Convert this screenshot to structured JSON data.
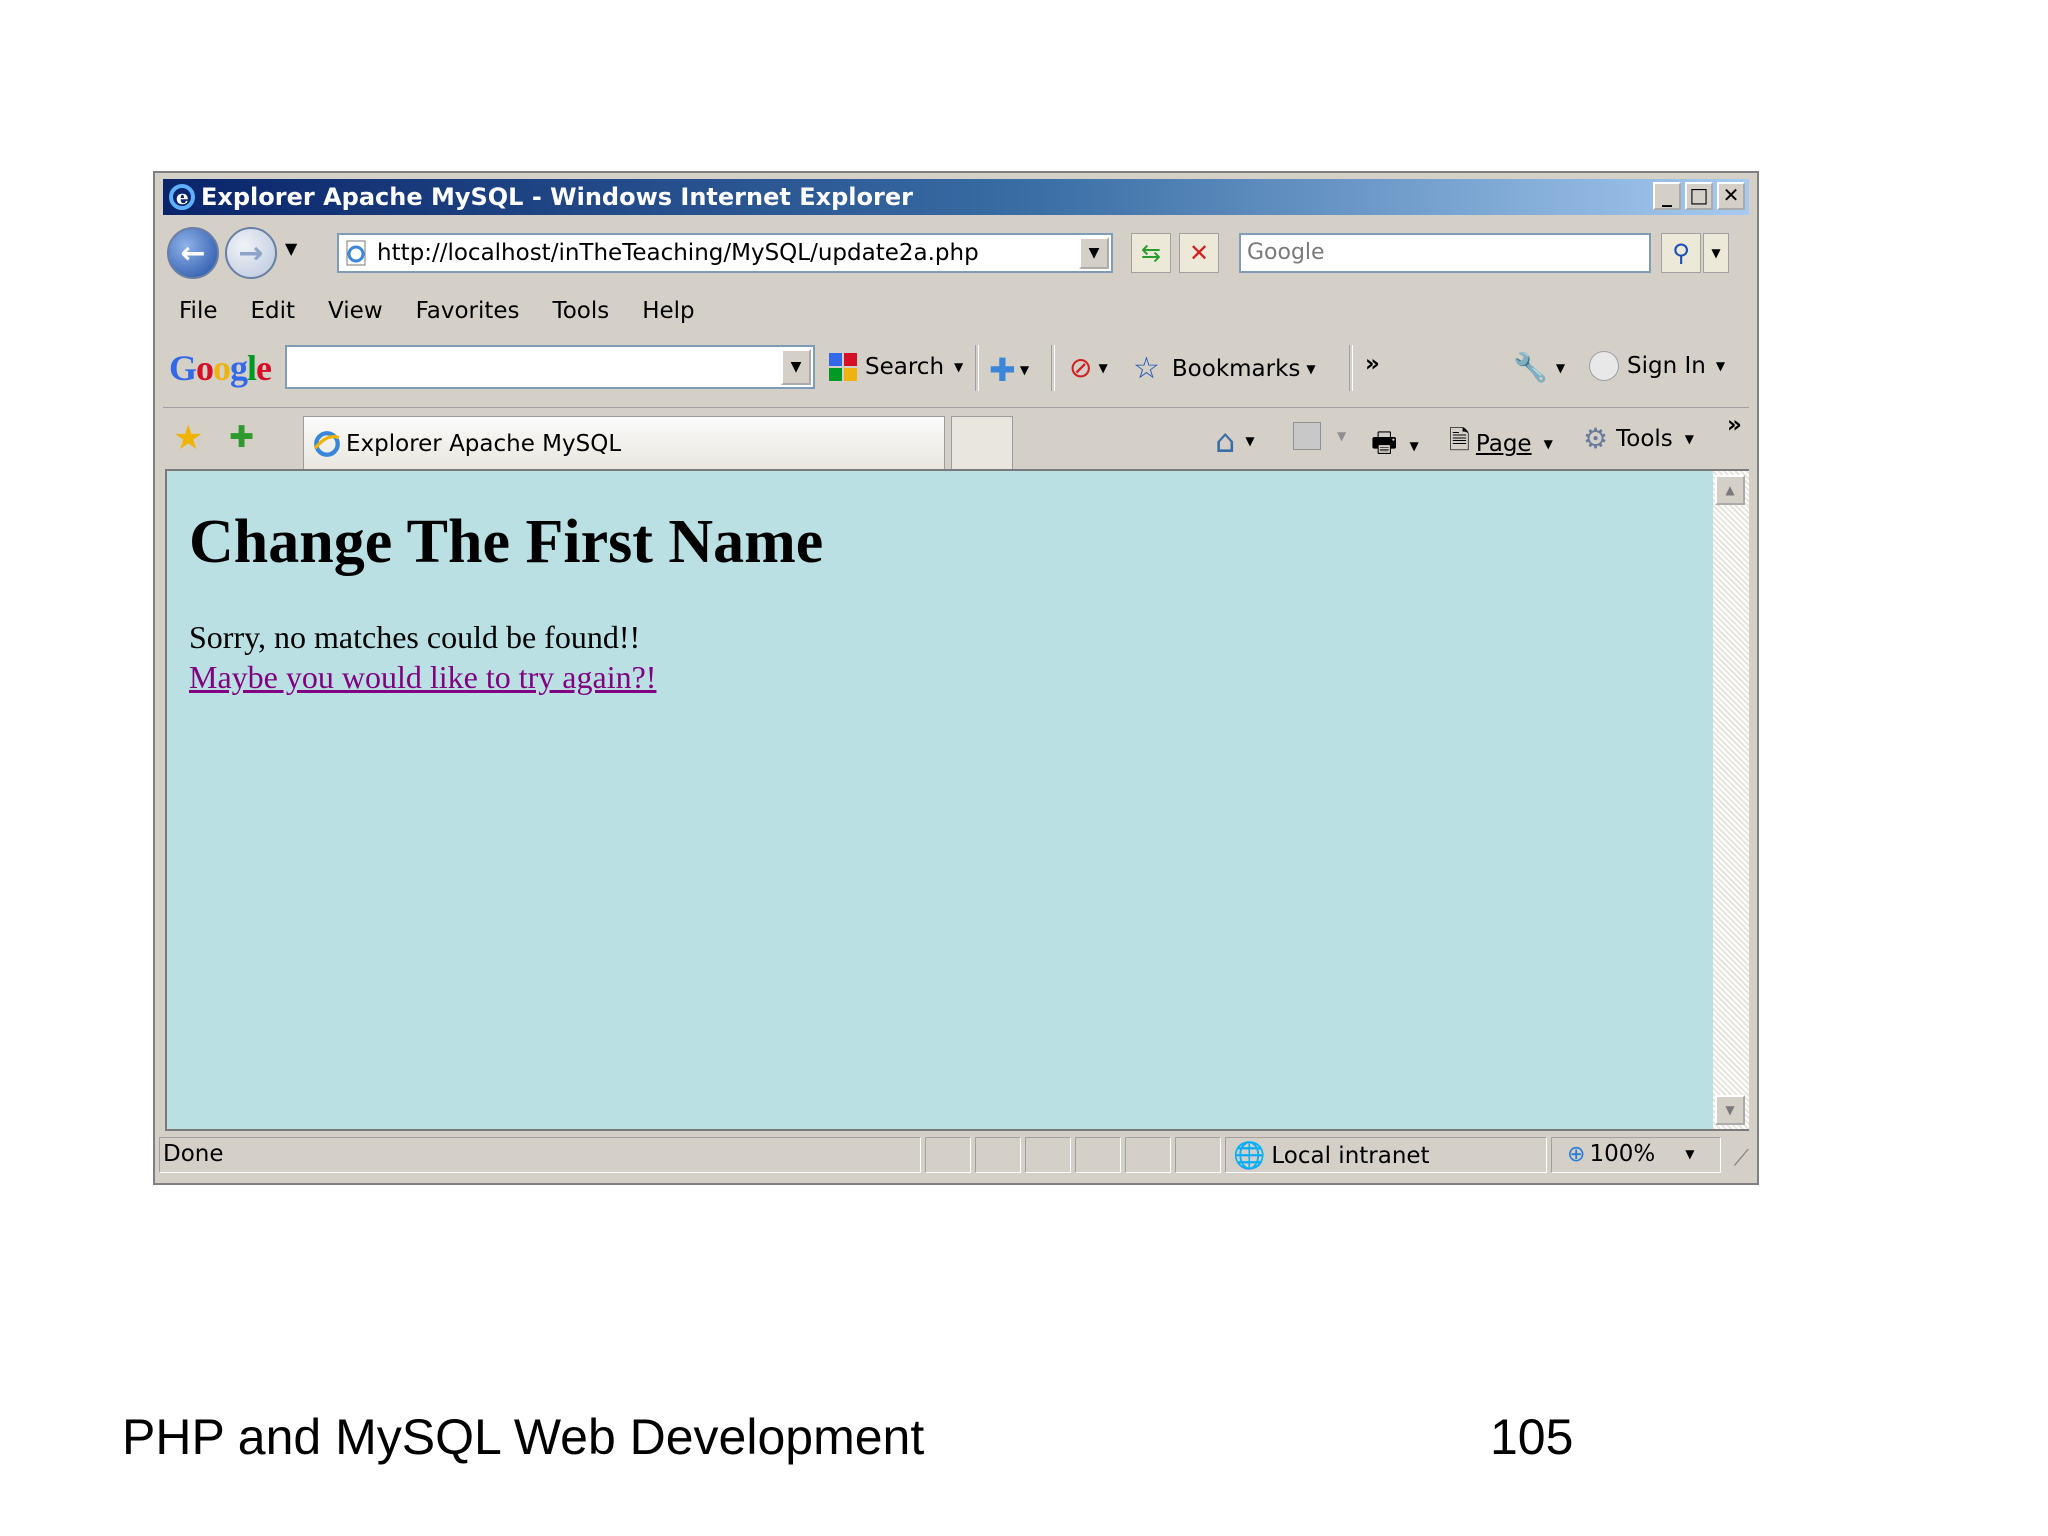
{
  "window": {
    "title": "Explorer Apache MySQL - Windows Internet Explorer",
    "controls": {
      "minimize": "_",
      "maximize": "□",
      "close": "✕"
    }
  },
  "nav": {
    "url": "http://localhost/inTheTeaching/MySQL/update2a.php",
    "search_placeholder": "Google"
  },
  "menu": [
    "File",
    "Edit",
    "View",
    "Favorites",
    "Tools",
    "Help"
  ],
  "google_toolbar": {
    "logo": "Google",
    "search_label": "Search",
    "bookmarks_label": "Bookmarks",
    "more": "»",
    "sign_in": "Sign In"
  },
  "tabs": {
    "active_title": "Explorer Apache MySQL"
  },
  "command_bar": {
    "page_label": "Page",
    "tools_label": "Tools",
    "more": "»"
  },
  "page": {
    "heading": "Change The First Name",
    "message": "Sorry, no matches could be found!!",
    "link": "Maybe you would like to try again?!"
  },
  "status": {
    "text": "Done",
    "zone": "Local intranet",
    "zoom": "100%"
  },
  "slide": {
    "footer": "PHP and MySQL Web Development",
    "page_number": "105"
  },
  "colors": {
    "content_bg": "#bae0e4",
    "visited_link": "#800080",
    "titlebar_start": "#0a246a",
    "titlebar_end": "#a6caf0"
  }
}
